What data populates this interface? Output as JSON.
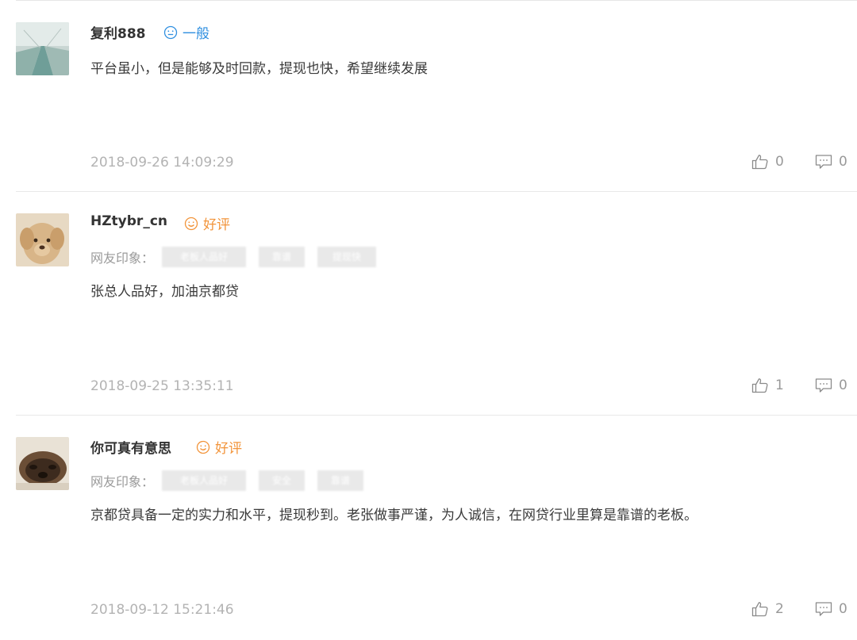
{
  "comments": [
    {
      "username": "复利888",
      "rating": {
        "label": "一般",
        "color": "#2f8fe0"
      },
      "impression": null,
      "text": "平台虽小，但是能够及时回款，提现也快，希望继续发展",
      "timestamp": "2018-09-26 14:09:29",
      "likes": "0",
      "replies": "0"
    },
    {
      "username": "HZtybr_cn",
      "rating": {
        "label": "好评",
        "color": "#f2943a"
      },
      "impression": {
        "label": "网友印象：",
        "tags": [
          "老板人品好",
          "靠谱",
          "提现快"
        ]
      },
      "text": "张总人品好，加油京都贷",
      "timestamp": "2018-09-25 13:35:11",
      "likes": "1",
      "replies": "0"
    },
    {
      "username": "你可真有意思",
      "rating": {
        "label": "好评",
        "color": "#f2943a"
      },
      "impression": {
        "label": "网友印象：",
        "tags": [
          "老板人品好",
          "安全",
          "靠谱"
        ]
      },
      "text": "京都贷具备一定的实力和水平，提现秒到。老张做事严谨，为人诚信，在网贷行业里算是靠谱的老板。",
      "timestamp": "2018-09-12 15:21:46",
      "likes": "2",
      "replies": "0"
    }
  ],
  "icons": {
    "like": "thumbs-up-icon",
    "reply": "comment-bubble-icon",
    "rating": "smiley-face-icon"
  }
}
